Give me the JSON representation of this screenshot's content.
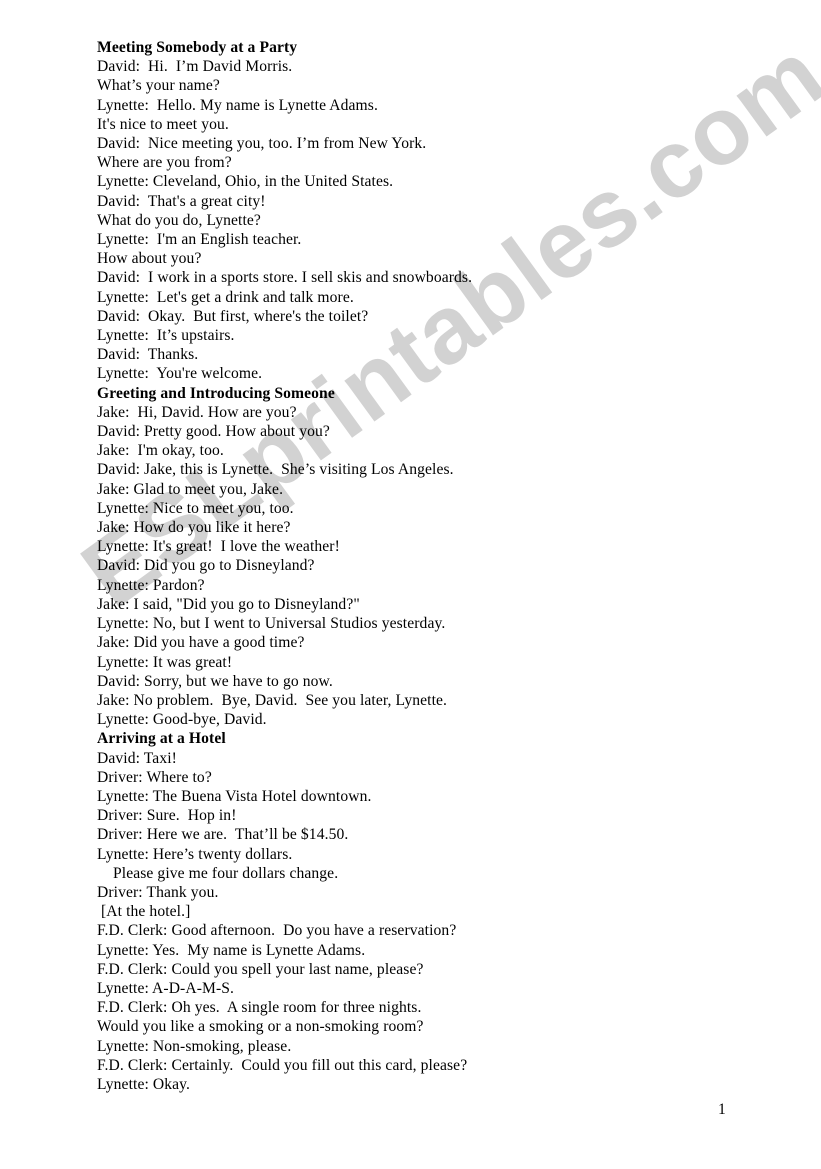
{
  "document": {
    "watermark": "ESLprintables.com",
    "watermark_color": "#d2d2d2",
    "text_color": "#000000",
    "background_color": "#ffffff",
    "page_number": "1"
  },
  "sections": [
    {
      "heading": "Meeting Somebody at a Party",
      "lines": [
        "David:  Hi.  I’m David Morris.",
        "What’s your name?",
        "Lynette:  Hello. My name is Lynette Adams.",
        "It's nice to meet you.",
        "David:  Nice meeting you, too. I’m from New York.",
        "Where are you from?",
        "Lynette: Cleveland, Ohio, in the United States.",
        "David:  That's a great city!",
        "What do you do, Lynette?",
        "Lynette:  I'm an English teacher.",
        "How about you?",
        "David:  I work in a sports store. I sell skis and snowboards.",
        "Lynette:  Let's get a drink and talk more.",
        "David:  Okay.  But first, where's the toilet?",
        "Lynette:  It’s upstairs.",
        "David:  Thanks.",
        "Lynette:  You're welcome."
      ]
    },
    {
      "heading": "Greeting and Introducing Someone",
      "lines": [
        "Jake:  Hi, David. How are you?",
        "David: Pretty good. How about you?",
        "Jake:  I'm okay, too.",
        "David: Jake, this is Lynette.  She’s visiting Los Angeles.",
        "Jake: Glad to meet you, Jake.",
        "Lynette: Nice to meet you, too.",
        "Jake: How do you like it here?",
        "Lynette: It's great!  I love the weather!",
        "David: Did you go to Disneyland?",
        "Lynette: Pardon?",
        "Jake: I said, \"Did you go to Disneyland?\"",
        "Lynette: No, but I went to Universal Studios yesterday.",
        "Jake: Did you have a good time?",
        "Lynette: It was great!",
        "David: Sorry, but we have to go now.",
        "Jake: No problem.  Bye, David.  See you later, Lynette.",
        "Lynette: Good-bye, David."
      ]
    },
    {
      "heading": "Arriving at a Hotel",
      "lines": [
        "David: Taxi!",
        "Driver: Where to?",
        "Lynette: The Buena Vista Hotel downtown.",
        "Driver: Sure.  Hop in!",
        "Driver: Here we are.  That’ll be $14.50.",
        "Lynette: Here’s twenty dollars.",
        "    Please give me four dollars change.",
        "Driver: Thank you.",
        " [At the hotel.]",
        "F.D. Clerk: Good afternoon.  Do you have a reservation?",
        "Lynette: Yes.  My name is Lynette Adams.",
        "F.D. Clerk: Could you spell your last name, please?",
        "Lynette: A-D-A-M-S.",
        "F.D. Clerk: Oh yes.  A single room for three nights.",
        "Would you like a smoking or a non-smoking room?",
        "Lynette: Non-smoking, please.",
        "F.D. Clerk: Certainly.  Could you fill out this card, please?",
        "Lynette: Okay."
      ]
    }
  ]
}
